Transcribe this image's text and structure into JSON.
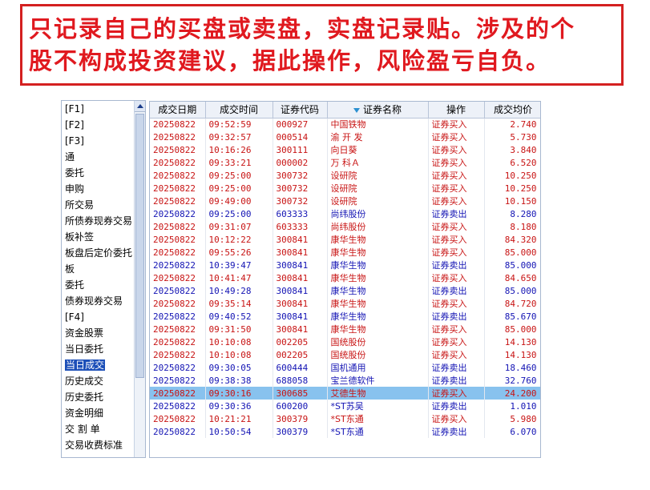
{
  "banner": {
    "line1": "只记录自己的买盘或卖盘，实盘记录贴。涉及的个",
    "line2": "股不构成投资建议，据此操作，风险盈亏自负。"
  },
  "sidebar": {
    "items": [
      {
        "label": "[F1]"
      },
      {
        "label": "[F2]"
      },
      {
        "label": "[F3]"
      },
      {
        "label": "通"
      },
      {
        "label": "委托"
      },
      {
        "label": "申购"
      },
      {
        "label": "所交易"
      },
      {
        "label": "所债券现券交易"
      },
      {
        "label": "板补签"
      },
      {
        "label": "板盘后定价委托"
      },
      {
        "label": "板"
      },
      {
        "label": "委托"
      },
      {
        "label": "债券现券交易"
      },
      {
        "label": "[F4]"
      },
      {
        "label": "资金股票"
      },
      {
        "label": "当日委托"
      },
      {
        "label": "当日成交"
      },
      {
        "label": "历史成交"
      },
      {
        "label": "历史委托"
      },
      {
        "label": "资金明细"
      },
      {
        "label": "交 割 单"
      },
      {
        "label": "交易收费标准"
      }
    ],
    "selected_label": "当日成交"
  },
  "table": {
    "columns": [
      "成交日期",
      "成交时间",
      "证券代码",
      "证券名称",
      "操作",
      "成交均价"
    ],
    "rows": [
      {
        "date": "20250822",
        "time": "09:52:59",
        "code": "000927",
        "name": "中国铁物",
        "op": "证券买入",
        "price": "2.740"
      },
      {
        "date": "20250822",
        "time": "09:32:57",
        "code": "000514",
        "name": "渝 开 发",
        "op": "证券买入",
        "price": "5.730"
      },
      {
        "date": "20250822",
        "time": "10:16:26",
        "code": "300111",
        "name": "向日葵",
        "op": "证券买入",
        "price": "3.840"
      },
      {
        "date": "20250822",
        "time": "09:33:21",
        "code": "000002",
        "name": "万 科Ａ",
        "op": "证券买入",
        "price": "6.520"
      },
      {
        "date": "20250822",
        "time": "09:25:00",
        "code": "300732",
        "name": "设研院",
        "op": "证券买入",
        "price": "10.250"
      },
      {
        "date": "20250822",
        "time": "09:25:00",
        "code": "300732",
        "name": "设研院",
        "op": "证券买入",
        "price": "10.250"
      },
      {
        "date": "20250822",
        "time": "09:49:00",
        "code": "300732",
        "name": "设研院",
        "op": "证券买入",
        "price": "10.150"
      },
      {
        "date": "20250822",
        "time": "09:25:00",
        "code": "603333",
        "name": "尚纬股份",
        "op": "证券卖出",
        "price": "8.280"
      },
      {
        "date": "20250822",
        "time": "09:31:07",
        "code": "603333",
        "name": "尚纬股份",
        "op": "证券买入",
        "price": "8.180"
      },
      {
        "date": "20250822",
        "time": "10:12:22",
        "code": "300841",
        "name": "康华生物",
        "op": "证券买入",
        "price": "84.320"
      },
      {
        "date": "20250822",
        "time": "09:55:26",
        "code": "300841",
        "name": "康华生物",
        "op": "证券买入",
        "price": "85.000"
      },
      {
        "date": "20250822",
        "time": "10:39:47",
        "code": "300841",
        "name": "康华生物",
        "op": "证券卖出",
        "price": "85.000"
      },
      {
        "date": "20250822",
        "time": "10:41:47",
        "code": "300841",
        "name": "康华生物",
        "op": "证券买入",
        "price": "84.650"
      },
      {
        "date": "20250822",
        "time": "10:49:28",
        "code": "300841",
        "name": "康华生物",
        "op": "证券卖出",
        "price": "85.000"
      },
      {
        "date": "20250822",
        "time": "09:35:14",
        "code": "300841",
        "name": "康华生物",
        "op": "证券买入",
        "price": "84.720"
      },
      {
        "date": "20250822",
        "time": "09:40:52",
        "code": "300841",
        "name": "康华生物",
        "op": "证券卖出",
        "price": "85.670"
      },
      {
        "date": "20250822",
        "time": "09:31:50",
        "code": "300841",
        "name": "康华生物",
        "op": "证券买入",
        "price": "85.000"
      },
      {
        "date": "20250822",
        "time": "10:10:08",
        "code": "002205",
        "name": "国统股份",
        "op": "证券买入",
        "price": "14.130"
      },
      {
        "date": "20250822",
        "time": "10:10:08",
        "code": "002205",
        "name": "国统股份",
        "op": "证券买入",
        "price": "14.130"
      },
      {
        "date": "20250822",
        "time": "09:30:05",
        "code": "600444",
        "name": "国机通用",
        "op": "证券卖出",
        "price": "18.460"
      },
      {
        "date": "20250822",
        "time": "09:38:38",
        "code": "688058",
        "name": "宝兰德软件",
        "op": "证券卖出",
        "price": "32.760"
      },
      {
        "date": "20250822",
        "time": "09:30:16",
        "code": "300685",
        "name": "艾德生物",
        "op": "证券买入",
        "price": "24.200"
      },
      {
        "date": "20250822",
        "time": "09:30:36",
        "code": "600200",
        "name": "*ST苏吴",
        "op": "证券卖出",
        "price": "1.010"
      },
      {
        "date": "20250822",
        "time": "10:21:21",
        "code": "300379",
        "name": "*ST东通",
        "op": "证券买入",
        "price": "5.980"
      },
      {
        "date": "20250822",
        "time": "10:50:54",
        "code": "300379",
        "name": "*ST东通",
        "op": "证券卖出",
        "price": "6.070"
      }
    ],
    "highlight_code": "300685",
    "sell_label": "证券卖出"
  },
  "colors": {
    "banner_text": "#e0191f",
    "buy_text": "#c81414",
    "sell_text": "#1414b4",
    "highlight_row": "#88c2ee",
    "selected_nav": "#1c4fb8"
  }
}
